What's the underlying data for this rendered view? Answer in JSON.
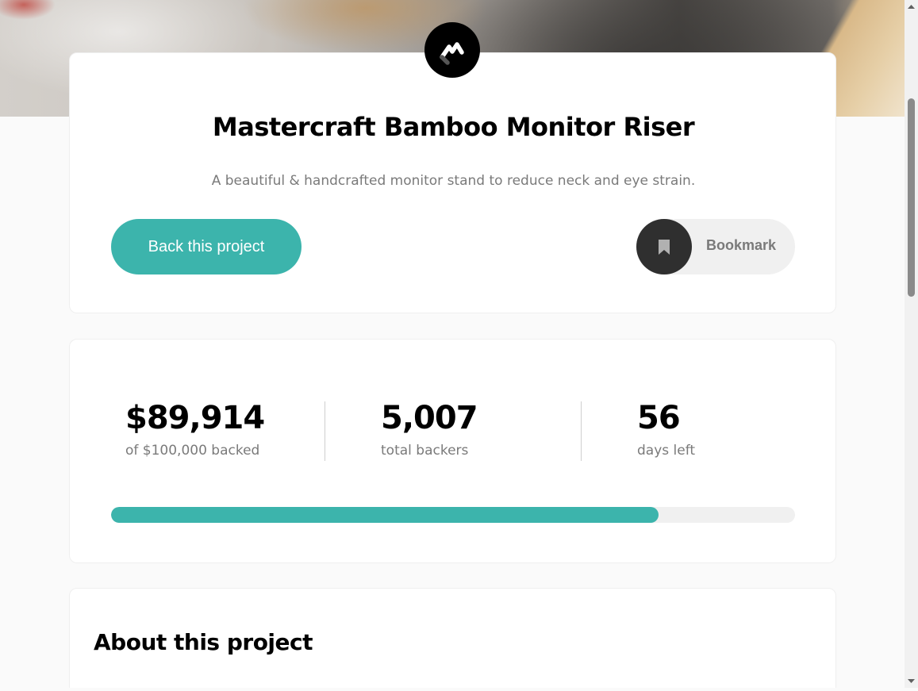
{
  "project": {
    "title": "Mastercraft Bamboo Monitor Riser",
    "description": "A beautiful & handcrafted monitor stand to reduce neck and eye strain.",
    "back_button": "Back this project",
    "bookmark_button": "Bookmark"
  },
  "stats": {
    "backed_amount": "$89,914",
    "backed_label": "of $100,000 backed",
    "backers_count": "5,007",
    "backers_label": "total backers",
    "days_left": "56",
    "days_label": "days left",
    "progress_fraction": 0.8
  },
  "about": {
    "heading": "About this project"
  },
  "colors": {
    "accent": "#3cb4ac",
    "dark": "#2f2f2f",
    "muted_text": "#7a7a7a"
  },
  "icons": {
    "logo": "mastercraft-logo-icon",
    "bookmark": "bookmark-icon",
    "scroll_up": "arrow-up-icon",
    "scroll_down": "arrow-down-icon"
  }
}
